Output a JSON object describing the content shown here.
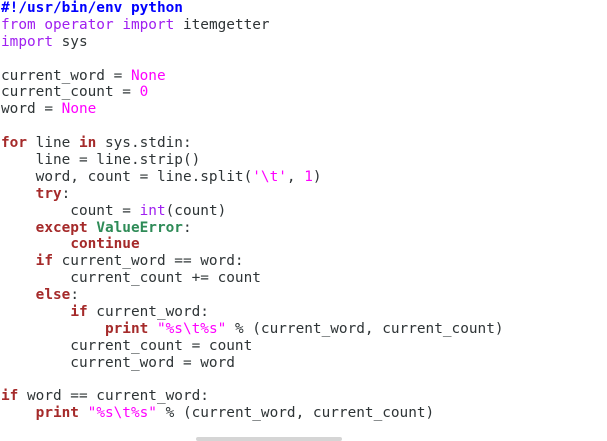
{
  "editor": {
    "language": "python",
    "colors": {
      "background": "#ffffff",
      "text": "#2e3436",
      "keyword": "#a52a2a",
      "import": "#a020f0",
      "constant": "#ff00ff",
      "string": "#ff00ff",
      "exception": "#2e8b57",
      "shebang": "#0000ff"
    },
    "lines": [
      [
        {
          "t": "shebang",
          "v": "#!/usr/bin/env python"
        }
      ],
      [
        {
          "t": "import",
          "v": "from"
        },
        {
          "t": "plain",
          "v": " "
        },
        {
          "t": "import",
          "v": "operator"
        },
        {
          "t": "plain",
          "v": " "
        },
        {
          "t": "import",
          "v": "import"
        },
        {
          "t": "plain",
          "v": " itemgetter"
        }
      ],
      [
        {
          "t": "import",
          "v": "import"
        },
        {
          "t": "plain",
          "v": " sys"
        }
      ],
      [],
      [
        {
          "t": "plain",
          "v": "current_word = "
        },
        {
          "t": "const",
          "v": "None"
        }
      ],
      [
        {
          "t": "plain",
          "v": "current_count = "
        },
        {
          "t": "num",
          "v": "0"
        }
      ],
      [
        {
          "t": "plain",
          "v": "word = "
        },
        {
          "t": "const",
          "v": "None"
        }
      ],
      [],
      [
        {
          "t": "kw",
          "v": "for"
        },
        {
          "t": "plain",
          "v": " line "
        },
        {
          "t": "kw",
          "v": "in"
        },
        {
          "t": "plain",
          "v": " sys.stdin:"
        }
      ],
      [
        {
          "t": "plain",
          "v": "    line = line.strip()"
        }
      ],
      [
        {
          "t": "plain",
          "v": "    word, count = line.split("
        },
        {
          "t": "str",
          "v": "'\\t'"
        },
        {
          "t": "plain",
          "v": ", "
        },
        {
          "t": "num",
          "v": "1"
        },
        {
          "t": "plain",
          "v": ")"
        }
      ],
      [
        {
          "t": "plain",
          "v": "    "
        },
        {
          "t": "kw",
          "v": "try"
        },
        {
          "t": "plain",
          "v": ":"
        }
      ],
      [
        {
          "t": "plain",
          "v": "        count = "
        },
        {
          "t": "builtin",
          "v": "int"
        },
        {
          "t": "plain",
          "v": "(count)"
        }
      ],
      [
        {
          "t": "plain",
          "v": "    "
        },
        {
          "t": "kw",
          "v": "except"
        },
        {
          "t": "plain",
          "v": " "
        },
        {
          "t": "exc",
          "v": "ValueError"
        },
        {
          "t": "plain",
          "v": ":"
        }
      ],
      [
        {
          "t": "plain",
          "v": "        "
        },
        {
          "t": "kw",
          "v": "continue"
        }
      ],
      [
        {
          "t": "plain",
          "v": "    "
        },
        {
          "t": "kw",
          "v": "if"
        },
        {
          "t": "plain",
          "v": " current_word == word:"
        }
      ],
      [
        {
          "t": "plain",
          "v": "        current_count += count"
        }
      ],
      [
        {
          "t": "plain",
          "v": "    "
        },
        {
          "t": "kw",
          "v": "else"
        },
        {
          "t": "plain",
          "v": ":"
        }
      ],
      [
        {
          "t": "plain",
          "v": "        "
        },
        {
          "t": "kw",
          "v": "if"
        },
        {
          "t": "plain",
          "v": " current_word:"
        }
      ],
      [
        {
          "t": "plain",
          "v": "            "
        },
        {
          "t": "kw",
          "v": "print"
        },
        {
          "t": "plain",
          "v": " "
        },
        {
          "t": "str",
          "v": "\"%s\\t%s\""
        },
        {
          "t": "plain",
          "v": " % (current_word, current_count)"
        }
      ],
      [
        {
          "t": "plain",
          "v": "        current_count = count"
        }
      ],
      [
        {
          "t": "plain",
          "v": "        current_word = word"
        }
      ],
      [],
      [
        {
          "t": "kw",
          "v": "if"
        },
        {
          "t": "plain",
          "v": " word == current_word:"
        }
      ],
      [
        {
          "t": "plain",
          "v": "    "
        },
        {
          "t": "kw",
          "v": "print"
        },
        {
          "t": "plain",
          "v": " "
        },
        {
          "t": "str",
          "v": "\"%s\\t%s\""
        },
        {
          "t": "plain",
          "v": " % (current_word, current_count)"
        }
      ]
    ]
  },
  "scrollbar": {
    "orientation": "horizontal"
  }
}
